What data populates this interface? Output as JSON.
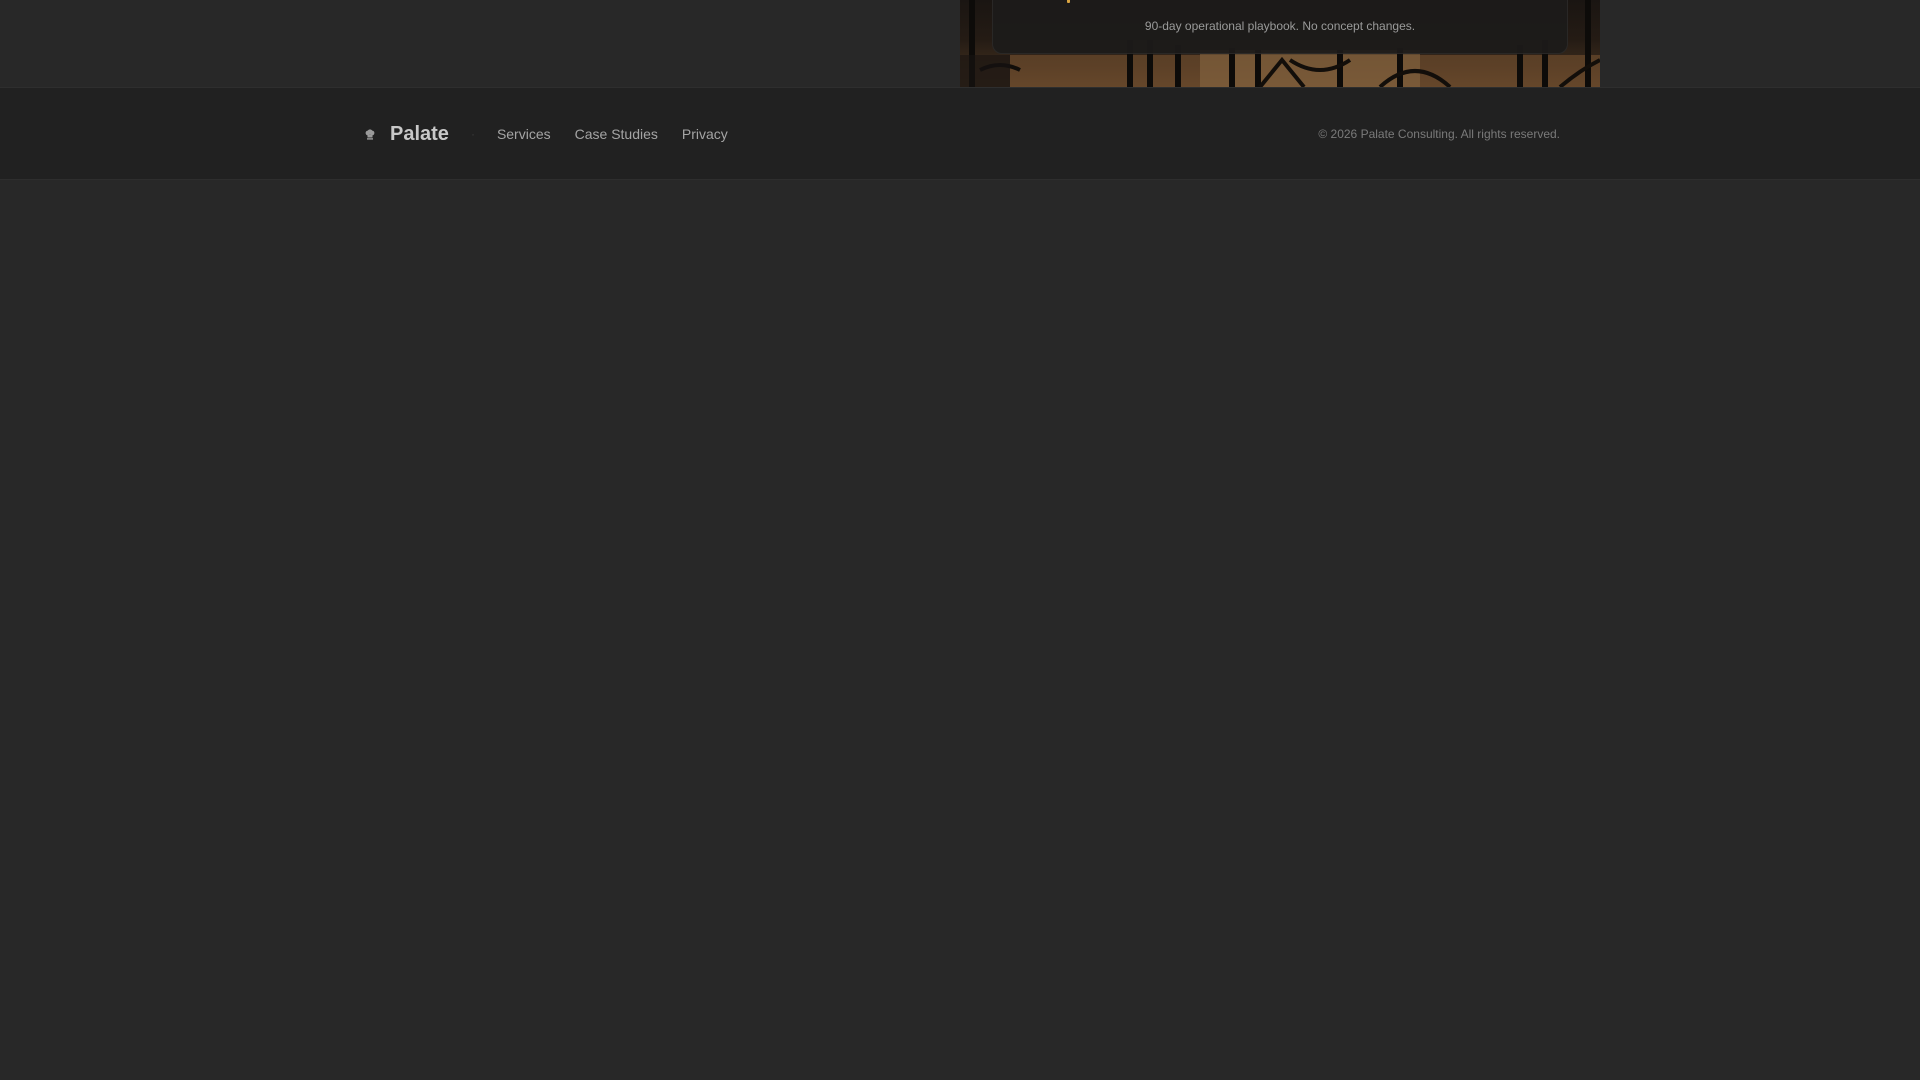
{
  "hero": {
    "playbook_note": "90-day operational playbook. No concept changes."
  },
  "footer": {
    "brand": {
      "name": "Palate",
      "icon": "chef-hat-icon",
      "separator": "·"
    },
    "nav": [
      {
        "label": "Services"
      },
      {
        "label": "Case Studies"
      },
      {
        "label": "Privacy"
      }
    ],
    "copyright": "© 2026 Palate Consulting. All rights reserved."
  },
  "colors": {
    "page_background": "#282828",
    "footer_background": "#212121",
    "accent": "#d9a441"
  }
}
